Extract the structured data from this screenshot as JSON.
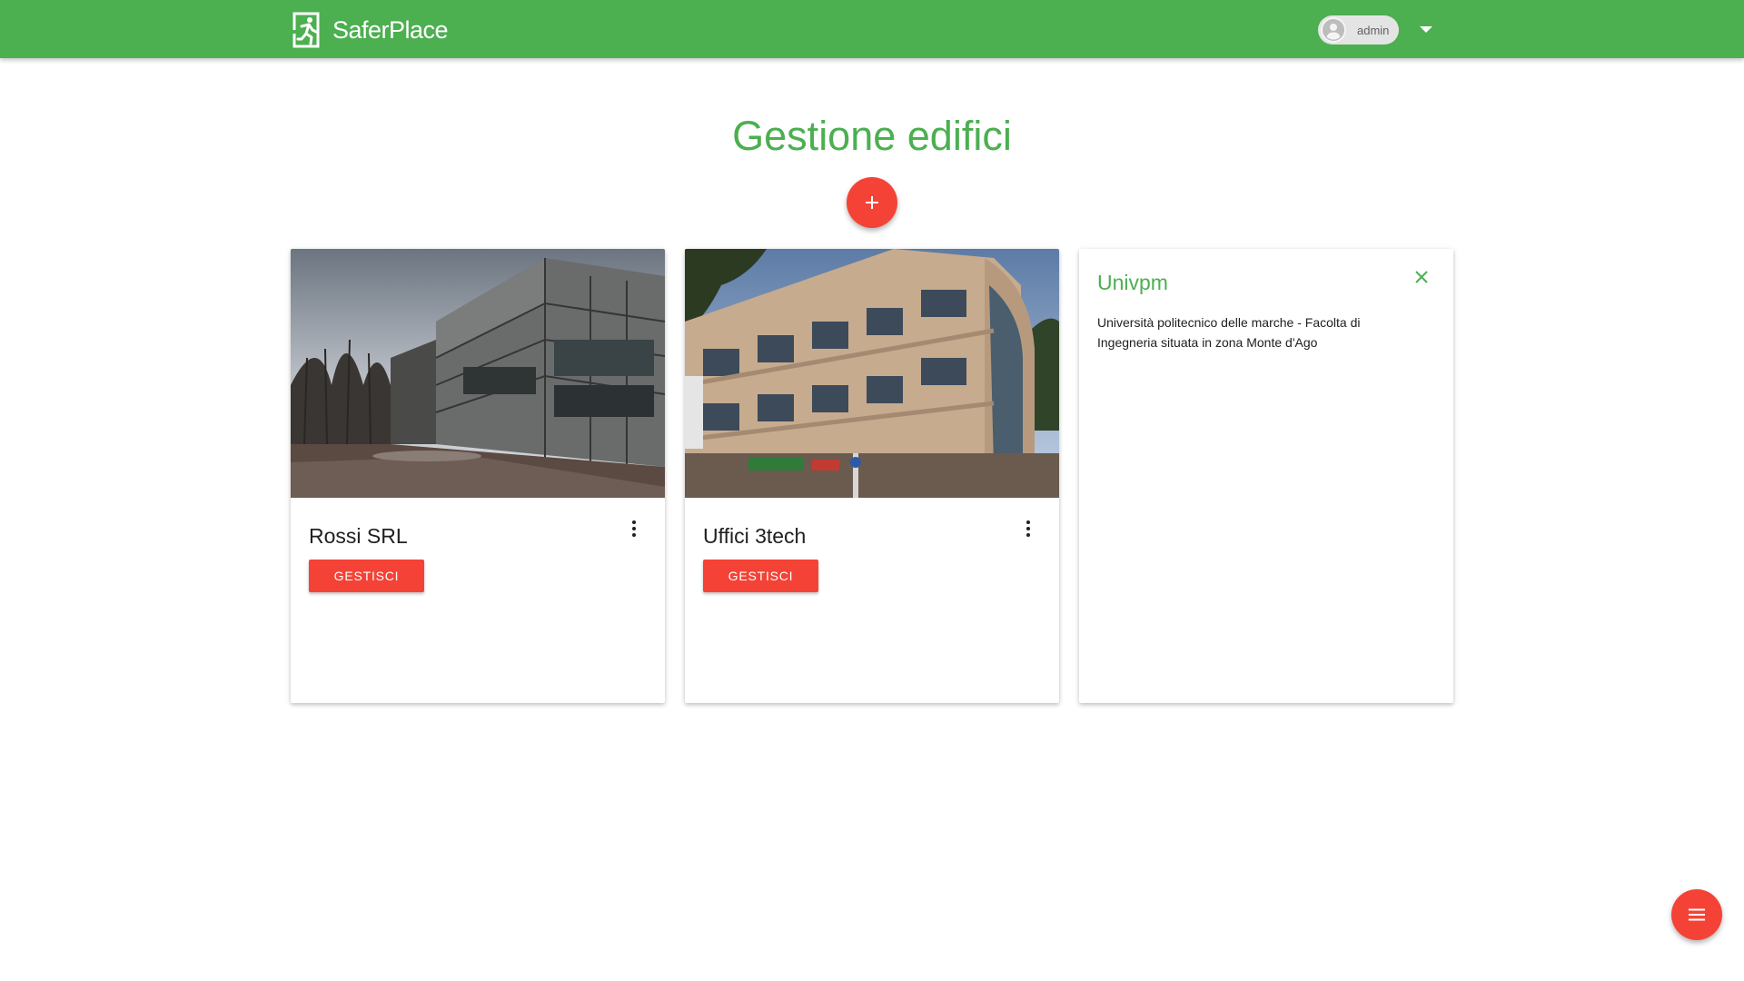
{
  "header": {
    "brand": "SaferPlace",
    "user": "admin",
    "dropdown_icon": "arrow-drop-down-icon"
  },
  "page": {
    "title": "Gestione edifici",
    "add_icon": "plus-icon"
  },
  "cards": [
    {
      "name": "Rossi SRL",
      "action_label": "GESTISCI",
      "image": "modern-glass-building-photo"
    },
    {
      "name": "Uffici 3tech",
      "action_label": "GESTISCI",
      "image": "curved-office-building-photo"
    },
    {
      "name": "Univpm",
      "description": "Università politecnico delle marche - Facolta di Ingegneria situata in zona Monte d'Ago",
      "close_icon": "close-icon"
    }
  ],
  "colors": {
    "primary": "#4caf50",
    "accent": "#f44336"
  },
  "fab_menu_icon": "menu-icon"
}
